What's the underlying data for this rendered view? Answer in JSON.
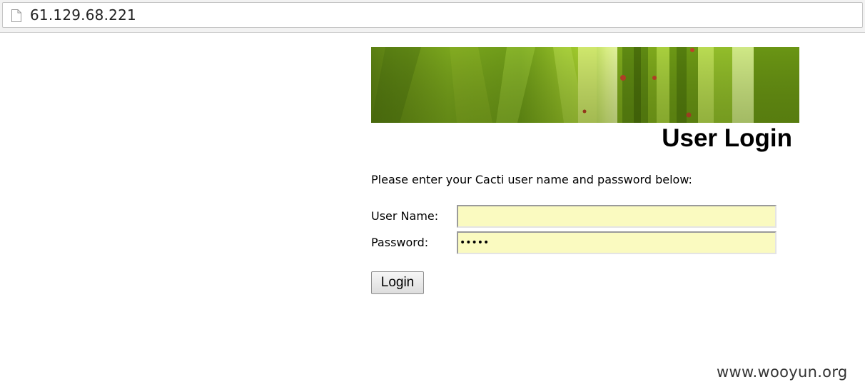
{
  "browser": {
    "url": "61.129.68.221",
    "page_icon": "document-icon"
  },
  "header": {
    "banner_image": "green-leaves-banner",
    "title": "User Login"
  },
  "form": {
    "instructions": "Please enter your Cacti user name and password below:",
    "username_label": "User Name:",
    "username_value": "",
    "password_label": "Password:",
    "password_value": "•••••",
    "field_color": "#fafac0",
    "submit_label": "Login"
  },
  "watermark": {
    "text": "www.wooyun.org"
  }
}
